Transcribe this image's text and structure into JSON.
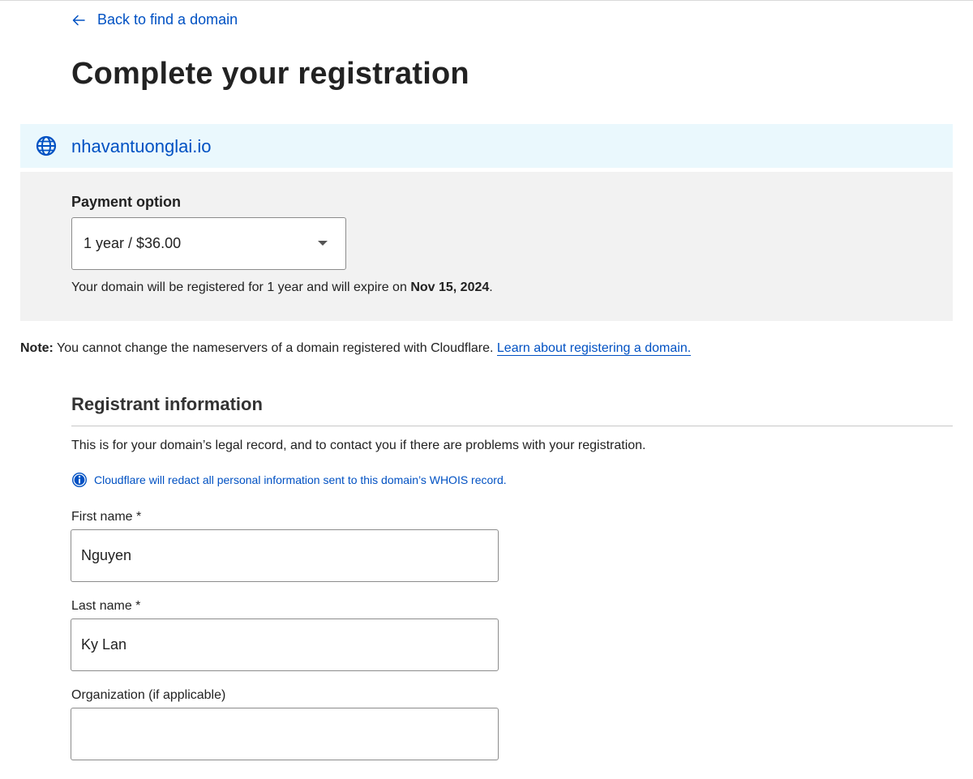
{
  "nav": {
    "back_label": "Back to find a domain"
  },
  "page": {
    "title": "Complete your registration"
  },
  "domain": {
    "name": "nhavantuonglai.io",
    "icon": "globe-icon"
  },
  "payment": {
    "label": "Payment option",
    "selected": "1 year / $36.00",
    "expiry_prefix": "Your domain will be registered for 1 year and will expire on",
    "expiry_date": "Nov 15, 2024",
    "expiry_suffix": "."
  },
  "note": {
    "bold": "Note:",
    "text": " You cannot change the nameservers of a domain registered with Cloudflare. ",
    "link": "Learn about registering a domain."
  },
  "registrant": {
    "title": "Registrant information",
    "description": "This is for your domain’s legal record, and to contact you if there are problems with your registration.",
    "info": "Cloudflare will redact all personal information sent to this domain’s WHOIS record.",
    "fields": {
      "first_name_label": "First name *",
      "first_name_value": "Nguyen",
      "last_name_label": "Last name *",
      "last_name_value": "Ky Lan",
      "organization_label": "Organization (if applicable)",
      "organization_value": ""
    }
  },
  "colors": {
    "link": "#0051c3",
    "banner_bg": "#eaf8fd",
    "panel_bg": "#f2f2f2"
  }
}
